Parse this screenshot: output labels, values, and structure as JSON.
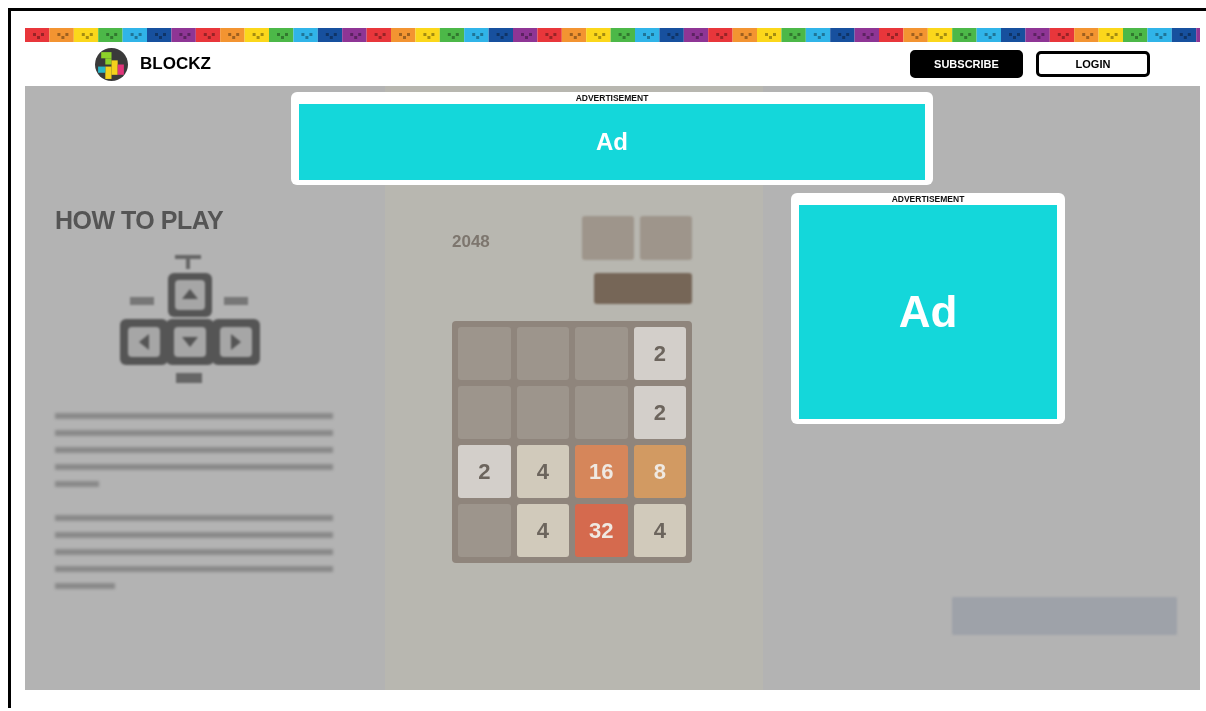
{
  "header": {
    "brand": "BLOCKZ",
    "buttons": [
      {
        "label": "SUBSCRIBE",
        "kind": "filled"
      },
      {
        "label": "LOGIN",
        "kind": "outline"
      }
    ]
  },
  "ads": [
    {
      "label": "ADVERTISEMENT",
      "text": "Ad"
    },
    {
      "label": "ADVERTISEMENT",
      "text": "Ad"
    }
  ],
  "how_to_play": {
    "title": "HOW TO PLAY"
  },
  "game": {
    "title": "2048",
    "board": [
      [
        {
          "color": "#9d958c"
        },
        {
          "color": "#9d958c"
        },
        {
          "color": "#9d958c"
        },
        {
          "value": "2",
          "color": "#d3cfca"
        }
      ],
      [
        {
          "color": "#9d958c"
        },
        {
          "color": "#9d958c"
        },
        {
          "color": "#9d958c"
        },
        {
          "value": "2",
          "color": "#d3cfca"
        }
      ],
      [
        {
          "value": "2",
          "color": "#d3cfca"
        },
        {
          "value": "4",
          "color": "#d1cabb"
        },
        {
          "value": "16",
          "color": "#d6865a"
        },
        {
          "value": "8",
          "color": "#d29a62"
        }
      ],
      [
        {
          "color": "#9d958c"
        },
        {
          "value": "4",
          "color": "#d1cabb"
        },
        {
          "value": "32",
          "color": "#d56a4e"
        },
        {
          "value": "4",
          "color": "#d1cabb"
        }
      ]
    ]
  }
}
